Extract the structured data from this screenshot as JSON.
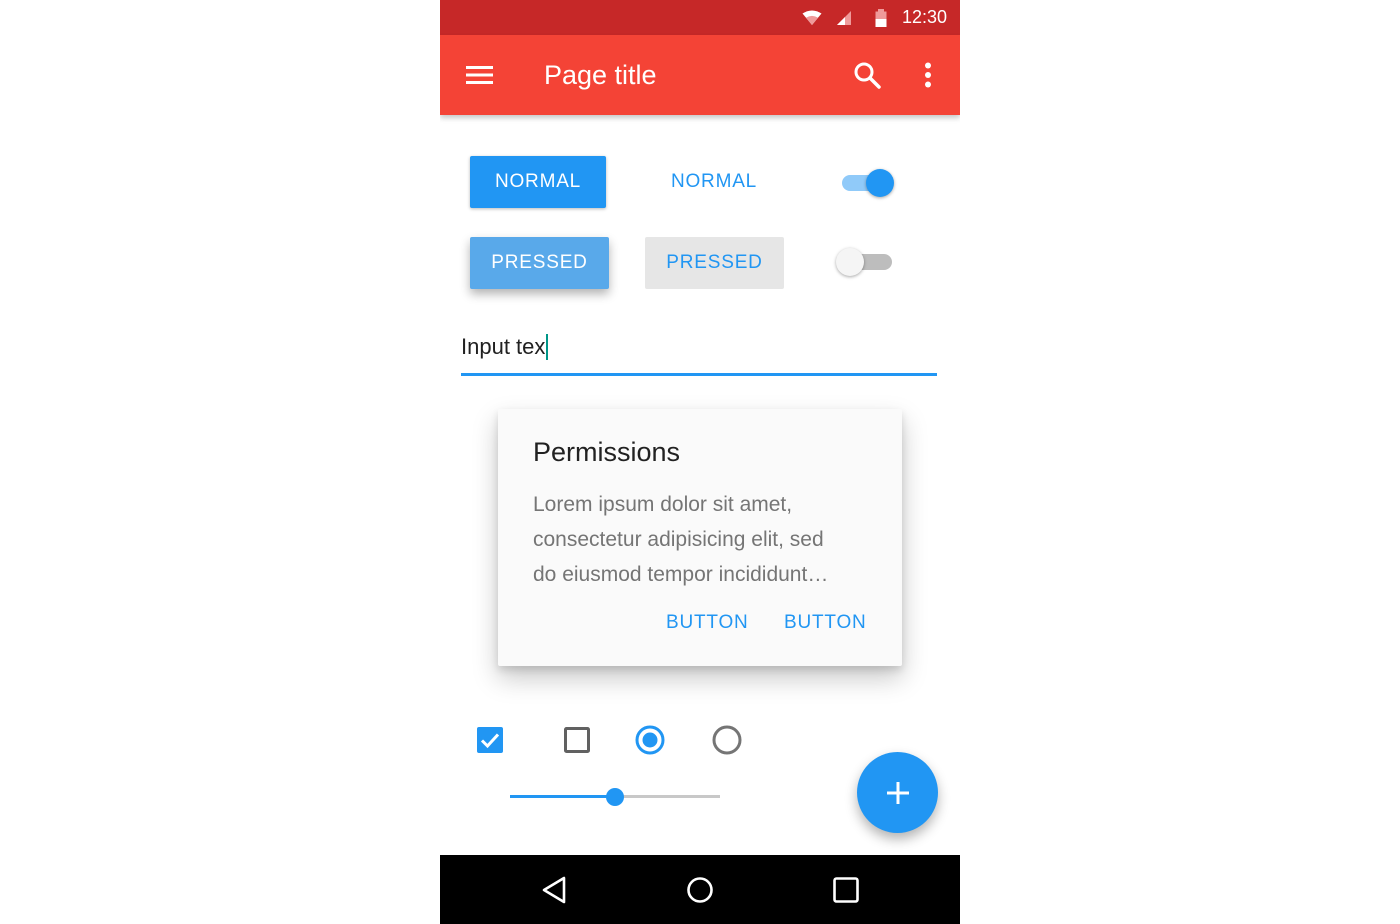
{
  "status_bar": {
    "time": "12:30",
    "background": "#c62828",
    "icons": [
      "wifi-icon",
      "signal-icon",
      "battery-icon"
    ]
  },
  "app_bar": {
    "title": "Page title",
    "background": "#f44336",
    "icons": [
      "menu-icon",
      "search-icon",
      "more-vert-icon"
    ]
  },
  "buttons": {
    "raised_normal": "NORMAL",
    "flat_normal": "NORMAL",
    "raised_pressed": "PRESSED",
    "flat_pressed": "PRESSED"
  },
  "switches": [
    {
      "state": "on"
    },
    {
      "state": "off"
    }
  ],
  "text_input": {
    "value": "Input tex",
    "accent": "#2196f3"
  },
  "dialog": {
    "title": "Permissions",
    "body_lines": [
      "Lorem ipsum dolor sit amet,",
      "consectetur adipisicing elit, sed",
      "do eiusmod tempor incididunt…"
    ],
    "buttons": [
      "BUTTON",
      "BUTTON"
    ]
  },
  "controls": {
    "checkbox_checked": true,
    "checkbox_unchecked": false,
    "radio_selected": true,
    "radio_unselected": false
  },
  "slider": {
    "value": 0.5
  },
  "fab": {
    "icon": "add-icon",
    "color": "#2196f3"
  },
  "nav_bar": {
    "icons": [
      "back-icon",
      "home-icon",
      "recents-icon"
    ]
  },
  "accent_color": "#2196f3"
}
